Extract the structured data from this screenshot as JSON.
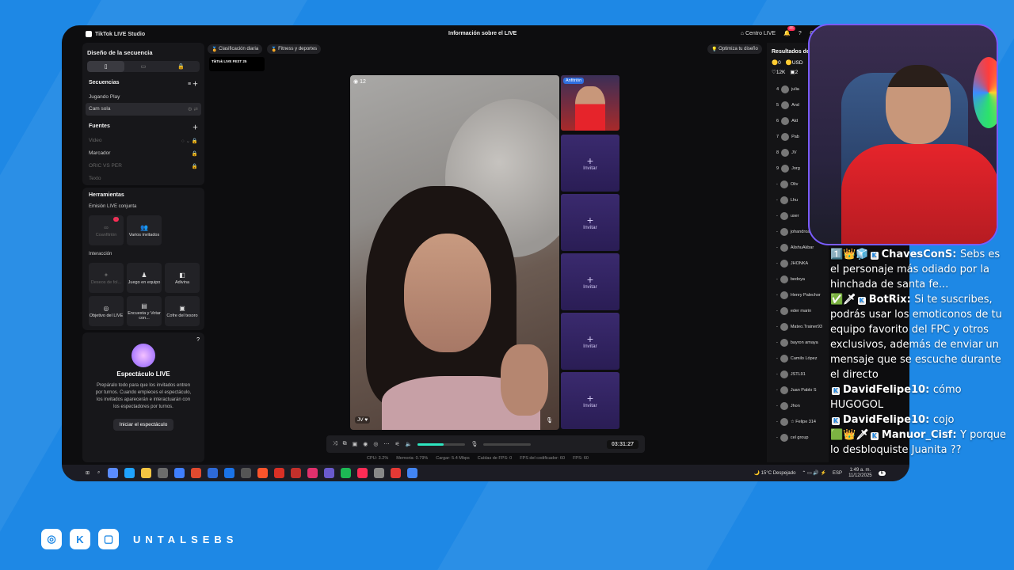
{
  "app": {
    "title": "TikTok LIVE Studio",
    "center_title": "Información sobre el LIVE",
    "centro_live": "Centro LIVE",
    "notif_count": "45"
  },
  "chips": {
    "ranking": "Clasificación diaria",
    "category": "Fitness y deportes",
    "optimize": "Optimiza tu diseño",
    "livefest": "TikTok LIVE FEST 25"
  },
  "left_panel": {
    "title": "Diseño de la secuencia",
    "scenes_header": "Secuencias",
    "scenes": [
      "Jugando Play",
      "Cam sola"
    ],
    "sources_header": "Fuentes",
    "sources": [
      "Video",
      "Marcador",
      "ORIC VS PER",
      "Texto"
    ],
    "tools_header": "Herramientas",
    "co_live": "Emisión LIVE conjunta",
    "tools_a": [
      {
        "label": "Coanfitrión",
        "badge": "1"
      },
      {
        "label": "Varios invitados",
        "badge": ""
      }
    ],
    "interaction": "Interacción",
    "tools_b": [
      "Deseos de fol...",
      "Juego en equipo",
      "Adivina",
      "Objetivo del LIVE",
      "Encuesta y Votar con...",
      "Cofre del tesoro"
    ]
  },
  "show": {
    "title": "Espectáculo LIVE",
    "desc": "Prepáralo todo para que los invitados entren por turnos. Cuando empieces el espectáculo, los invitados aparecerán e interactuarán con los espectadores por turnos.",
    "button": "Iniciar el espectáculo"
  },
  "stage": {
    "viewer_count": "12",
    "name_tag": "JV ♥",
    "host_label": "Anfitrión",
    "invite_label": "Invitar"
  },
  "controls": {
    "timer": "03:31:27",
    "volume_level": 0.55
  },
  "stats": {
    "cpu": "CPU: 3.2%",
    "mem": "Memoria: 0.79%",
    "load": "Cargar: 5.4 Mbps",
    "drop": "Caídas de FPS: 0",
    "enc": "FPS del codificador: 60",
    "fps": "FPS: 60"
  },
  "rank": {
    "title": "Resultados de",
    "coins": "0",
    "usd": "USD",
    "likes": "12K",
    "other": "2",
    "rows": [
      {
        "pos": "4",
        "name": "julia"
      },
      {
        "pos": "5",
        "name": "And"
      },
      {
        "pos": "6",
        "name": "Ald"
      },
      {
        "pos": "7",
        "name": "Pab"
      },
      {
        "pos": "8",
        "name": "JV"
      },
      {
        "pos": "9",
        "name": "Jorg"
      },
      {
        "pos": "-",
        "name": "Oliv"
      },
      {
        "pos": "-",
        "name": "Lhu"
      },
      {
        "pos": "-",
        "name": "user"
      },
      {
        "pos": "-",
        "name": "johandroa"
      },
      {
        "pos": "-",
        "name": "AlishuAkbar"
      },
      {
        "pos": "-",
        "name": "JHONKA"
      },
      {
        "pos": "-",
        "name": "bedoya"
      },
      {
        "pos": "-",
        "name": "Henry Palechor"
      },
      {
        "pos": "-",
        "name": "eder marin"
      },
      {
        "pos": "-",
        "name": "Mateo.Trainer93"
      },
      {
        "pos": "-",
        "name": "bayron amaya"
      },
      {
        "pos": "-",
        "name": "Camilo López"
      },
      {
        "pos": "-",
        "name": "JSTL91"
      },
      {
        "pos": "-",
        "name": "Juan Pablo S"
      },
      {
        "pos": "-",
        "name": "Jhon"
      },
      {
        "pos": "-",
        "name": "☆ Felipe 314"
      },
      {
        "pos": "-",
        "name": "cel group"
      }
    ]
  },
  "taskbar": {
    "weather": "15°C Despejado",
    "lang": "ESP",
    "time": "1:49 a. m.",
    "date": "11/12/2025",
    "notif": "6"
  },
  "chat": [
    {
      "prefix": "1️⃣👑🧊",
      "user": "ChavesConS",
      "msg": "Sebs es el personaje más odiado por la hinchada de santa fe..."
    },
    {
      "prefix": "✅🗡",
      "user": "BotRix",
      "msg": "Si te suscribes, podrás usar los emoticonos de tu equipo favorito del FPC y otros exclusivos, además de enviar un mensaje que se escuche durante el directo"
    },
    {
      "prefix": "",
      "user": "DavidFelipe10",
      "msg": "cómo HUGOGOL"
    },
    {
      "prefix": "",
      "user": "DavidFelipe10",
      "msg": "cojo"
    },
    {
      "prefix": "🟩👑🗡",
      "user": "Manuor_Cisf",
      "msg": "Y porque lo desbloquiste Juanita ??"
    }
  ],
  "brand": {
    "name": "UNTALSEBS"
  },
  "colors": {
    "bg": "#1e88e5",
    "accent": "#fe2c55",
    "teal": "#2ee6c0"
  }
}
